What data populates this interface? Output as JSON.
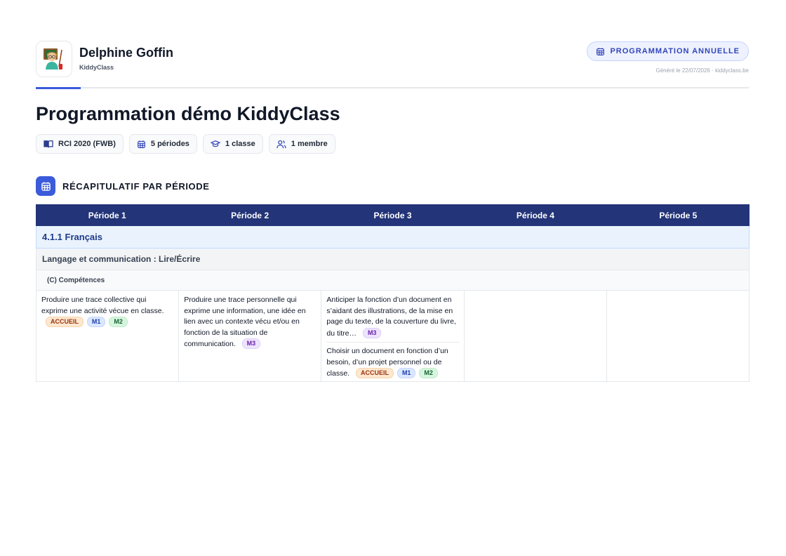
{
  "header": {
    "owner_name": "Delphine Goffin",
    "owner_subtitle": "KiddyClass",
    "badge_label": "PROGRAMMATION ANNUELLE",
    "generated_text": "Généré le 22/07/2026 · kiddyclass.be",
    "logo_icon": "teacher-avatar-icon"
  },
  "title": "Programmation démo KiddyClass",
  "chips": [
    {
      "icon": "book-icon",
      "label": "RCI 2020 (FWB)"
    },
    {
      "icon": "calendar-icon",
      "label": "5 périodes"
    },
    {
      "icon": "graduation-cap-icon",
      "label": "1 classe"
    },
    {
      "icon": "users-icon",
      "label": "1 membre"
    }
  ],
  "section": {
    "icon": "calendar-icon",
    "label": "RÉCAPITULATIF PAR PÉRIODE"
  },
  "table": {
    "headers": [
      "Période 1",
      "Période 2",
      "Période 3",
      "Période 4",
      "Période 5"
    ],
    "domain": "4.1.1 Français",
    "subdomain": "Langage et communication : Lire/Écrire",
    "category": "(C) Compétences",
    "cells": [
      [
        {
          "text": "Produire une trace collective qui exprime une activité vécue en classe.",
          "tags": [
            "ACCUEIL",
            "M1",
            "M2"
          ]
        }
      ],
      [
        {
          "text": "Produire une trace personnelle qui exprime une information, une idée en lien avec un contexte vécu et/ou en fonction de la situation de communication.",
          "tags": [
            "M3"
          ]
        }
      ],
      [
        {
          "text": "Anticiper la fonction d’un document en s’aidant des illustrations, de la mise en page du texte, de la couverture du livre, du titre…",
          "tags": [
            "M3"
          ]
        },
        {
          "text": "Choisir un document en fonction d’un besoin, d’un projet personnel ou de classe.",
          "tags": [
            "ACCUEIL",
            "M1",
            "M2"
          ]
        }
      ],
      [],
      []
    ]
  },
  "colors": {
    "accent": "#3b5bdb",
    "table_header": "#233478",
    "domain_bg": "#eaf3fd"
  }
}
